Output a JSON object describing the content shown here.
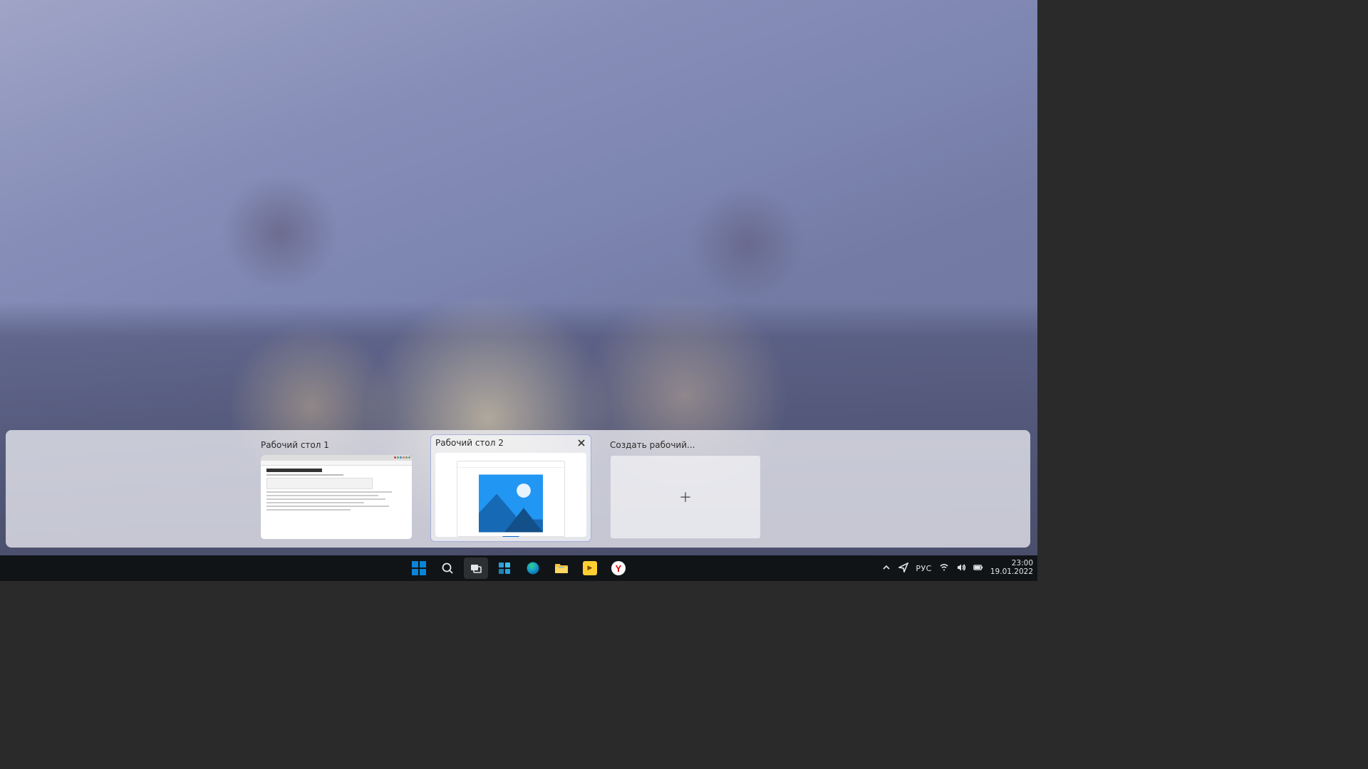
{
  "taskview": {
    "desktops": [
      {
        "label": "Рабочий стол 1"
      },
      {
        "label": "Рабочий стол 2"
      }
    ],
    "new_desktop_label": "Создать рабочий..."
  },
  "taskbar": {
    "start": "Пуск",
    "search": "Поиск",
    "task_view": "Представление задач",
    "widgets": "Мини-приложения",
    "edge": "Microsoft Edge",
    "explorer": "Проводник",
    "player_app": "Плеер",
    "yandex": "Yandex"
  },
  "tray": {
    "overflow": "Показать скрытые значки",
    "send": "Отправить",
    "language": "РУС",
    "wifi": "Wi-Fi",
    "volume": "Громкость",
    "battery": "Батарея",
    "time": "23:00",
    "date": "19.01.2022"
  }
}
